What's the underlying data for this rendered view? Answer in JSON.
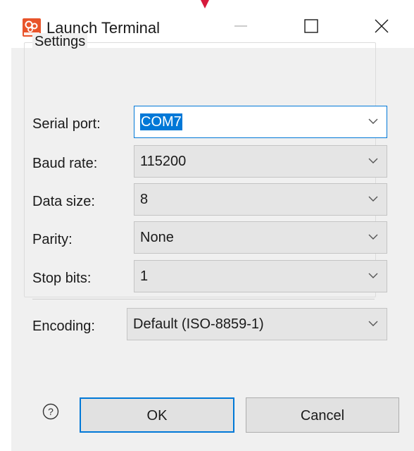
{
  "window": {
    "title": "Launch Terminal",
    "icon": "aurix-app-icon",
    "controls": [
      "minimize-icon",
      "maximize-icon",
      "close-icon"
    ]
  },
  "settings": {
    "legend": "Settings",
    "serial_port": {
      "label": "Serial port:",
      "value": "COM7"
    },
    "baud_rate": {
      "label": "Baud rate:",
      "value": "115200"
    },
    "data_size": {
      "label": "Data size:",
      "value": "8"
    },
    "parity": {
      "label": "Parity:",
      "value": "None"
    },
    "stop_bits": {
      "label": "Stop bits:",
      "value": "1"
    },
    "encoding": {
      "label": "Encoding:",
      "value": "Default (ISO-8859-1)"
    }
  },
  "buttons": {
    "ok_label": "OK",
    "cancel_label": "Cancel",
    "help_icon": "help-icon"
  },
  "colors": {
    "accent": "#0078d7",
    "app_icon": "#e8542b",
    "background": "#f0f0f0",
    "marker": "#d6193c"
  }
}
